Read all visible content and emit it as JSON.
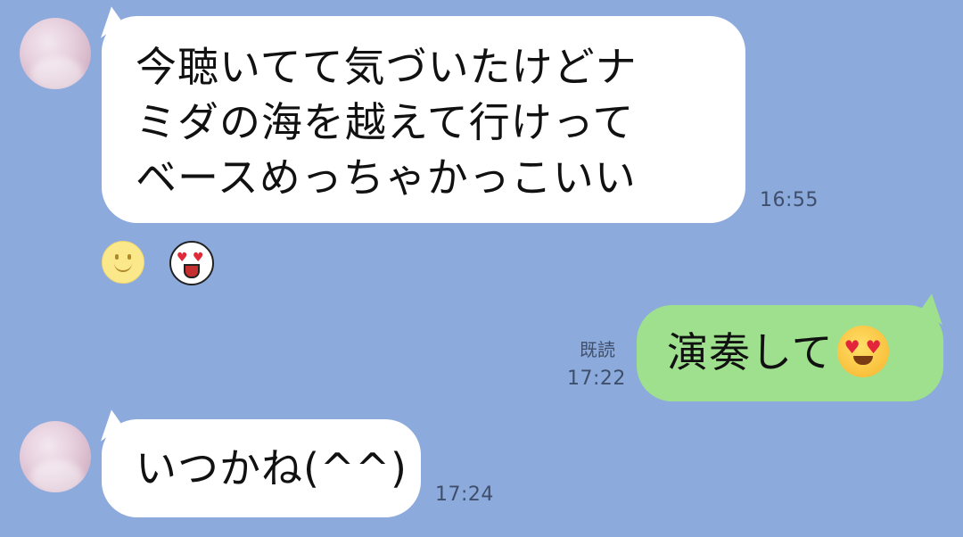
{
  "messages": [
    {
      "lines": [
        "今聴いてて気づいたけどナ",
        "ミダの海を越えて行けって",
        "ベースめっちゃかっこいい"
      ],
      "time": "16:55"
    },
    {
      "text": "演奏して",
      "emoji": "heart-eyes-emoji",
      "read": "既読",
      "time": "17:22"
    },
    {
      "text": "いつかね(^^)",
      "time": "17:24"
    }
  ],
  "reactions": [
    "smile-reaction-icon",
    "heart-eyes-reaction-icon"
  ],
  "colors": {
    "background": "#8caadc",
    "incoming_bubble": "#ffffff",
    "outgoing_bubble": "#9ee08d",
    "meta_text": "#3f4f6b"
  }
}
